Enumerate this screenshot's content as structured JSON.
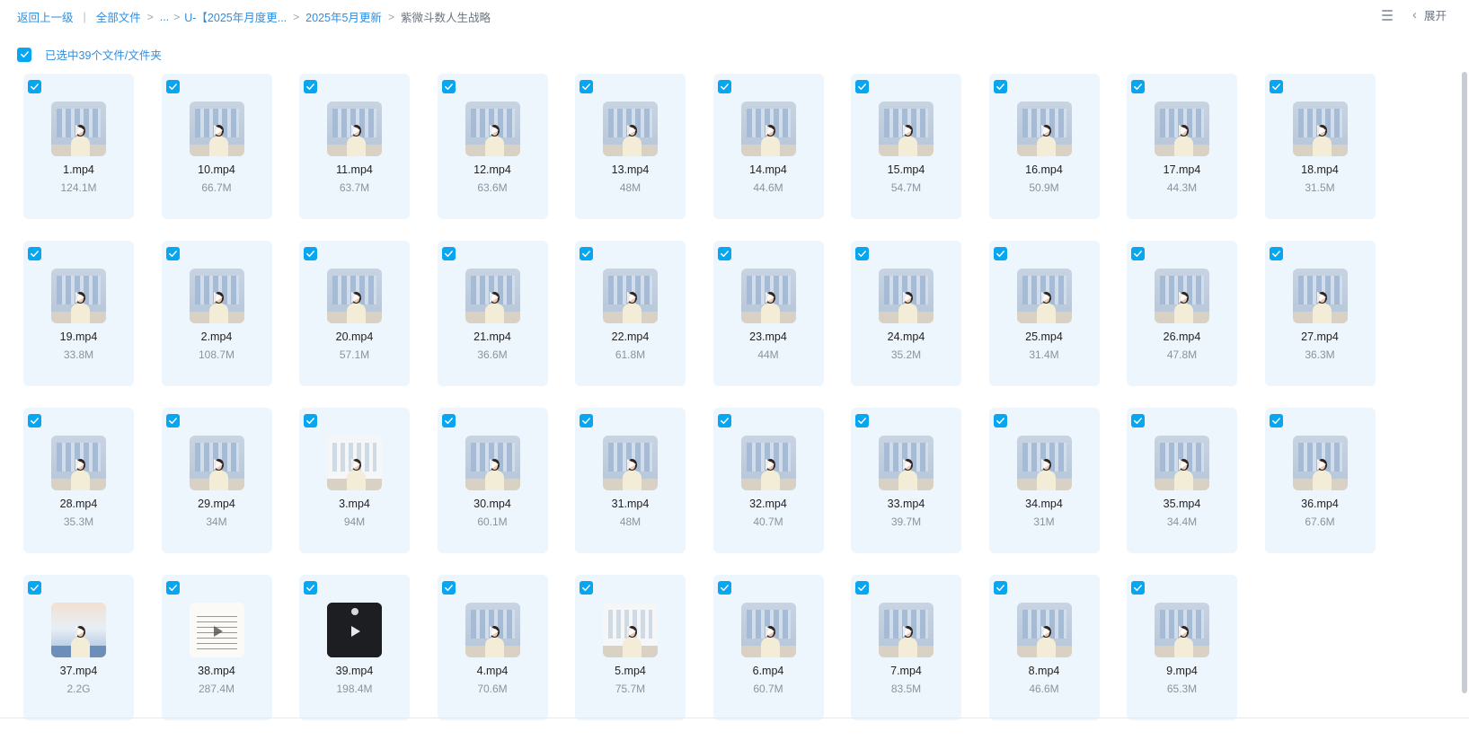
{
  "breadcrumb": {
    "back": "返回上一级",
    "all_files": "全部文件",
    "ellipsis": "...",
    "folder_u": "U-【2025年月度更...",
    "folder_may": "2025年5月更新",
    "current": "紫微斗数人生战略",
    "separator": "|",
    "arrow": ">"
  },
  "top_right": {
    "expand_label": "展开",
    "chevron": "‹"
  },
  "selection": {
    "text": "已选中39个文件/文件夹",
    "checked": true
  },
  "colors": {
    "accent": "#07a6f0",
    "link": "#2f8ee0",
    "card_bg": "#eef6fd"
  },
  "files": [
    {
      "name": "1.mp4",
      "size": "124.1M",
      "thumb": "teacher"
    },
    {
      "name": "10.mp4",
      "size": "66.7M",
      "thumb": "teacher"
    },
    {
      "name": "11.mp4",
      "size": "63.7M",
      "thumb": "teacher"
    },
    {
      "name": "12.mp4",
      "size": "63.6M",
      "thumb": "teacher"
    },
    {
      "name": "13.mp4",
      "size": "48M",
      "thumb": "teacher"
    },
    {
      "name": "14.mp4",
      "size": "44.6M",
      "thumb": "teacher"
    },
    {
      "name": "15.mp4",
      "size": "54.7M",
      "thumb": "teacher"
    },
    {
      "name": "16.mp4",
      "size": "50.9M",
      "thumb": "teacher"
    },
    {
      "name": "17.mp4",
      "size": "44.3M",
      "thumb": "teacher"
    },
    {
      "name": "18.mp4",
      "size": "31.5M",
      "thumb": "teacher"
    },
    {
      "name": "19.mp4",
      "size": "33.8M",
      "thumb": "teacher"
    },
    {
      "name": "2.mp4",
      "size": "108.7M",
      "thumb": "teacher"
    },
    {
      "name": "20.mp4",
      "size": "57.1M",
      "thumb": "teacher"
    },
    {
      "name": "21.mp4",
      "size": "36.6M",
      "thumb": "teacher"
    },
    {
      "name": "22.mp4",
      "size": "61.8M",
      "thumb": "teacher"
    },
    {
      "name": "23.mp4",
      "size": "44M",
      "thumb": "teacher"
    },
    {
      "name": "24.mp4",
      "size": "35.2M",
      "thumb": "teacher"
    },
    {
      "name": "25.mp4",
      "size": "31.4M",
      "thumb": "teacher"
    },
    {
      "name": "26.mp4",
      "size": "47.8M",
      "thumb": "teacher"
    },
    {
      "name": "27.mp4",
      "size": "36.3M",
      "thumb": "teacher"
    },
    {
      "name": "28.mp4",
      "size": "35.3M",
      "thumb": "teacher"
    },
    {
      "name": "29.mp4",
      "size": "34M",
      "thumb": "teacher"
    },
    {
      "name": "3.mp4",
      "size": "94M",
      "thumb": "light"
    },
    {
      "name": "30.mp4",
      "size": "60.1M",
      "thumb": "teacher"
    },
    {
      "name": "31.mp4",
      "size": "48M",
      "thumb": "teacher"
    },
    {
      "name": "32.mp4",
      "size": "40.7M",
      "thumb": "teacher"
    },
    {
      "name": "33.mp4",
      "size": "39.7M",
      "thumb": "teacher"
    },
    {
      "name": "34.mp4",
      "size": "31M",
      "thumb": "teacher"
    },
    {
      "name": "35.mp4",
      "size": "34.4M",
      "thumb": "teacher"
    },
    {
      "name": "36.mp4",
      "size": "67.6M",
      "thumb": "teacher"
    },
    {
      "name": "37.mp4",
      "size": "2.2G",
      "thumb": "sky"
    },
    {
      "name": "38.mp4",
      "size": "287.4M",
      "thumb": "doc"
    },
    {
      "name": "39.mp4",
      "size": "198.4M",
      "thumb": "dark"
    },
    {
      "name": "4.mp4",
      "size": "70.6M",
      "thumb": "teacher"
    },
    {
      "name": "5.mp4",
      "size": "75.7M",
      "thumb": "light"
    },
    {
      "name": "6.mp4",
      "size": "60.7M",
      "thumb": "teacher"
    },
    {
      "name": "7.mp4",
      "size": "83.5M",
      "thumb": "teacher"
    },
    {
      "name": "8.mp4",
      "size": "46.6M",
      "thumb": "teacher"
    },
    {
      "name": "9.mp4",
      "size": "65.3M",
      "thumb": "teacher"
    }
  ]
}
